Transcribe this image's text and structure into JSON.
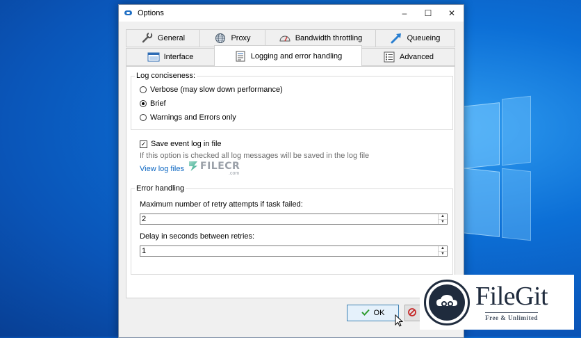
{
  "window": {
    "title": "Options",
    "controls": {
      "minimize": "–",
      "maximize": "☐",
      "close": "✕"
    }
  },
  "tabs": {
    "row1": [
      {
        "label": "General",
        "icon": "wrench-icon"
      },
      {
        "label": "Proxy",
        "icon": "globe-icon"
      },
      {
        "label": "Bandwidth throttling",
        "icon": "gauge-icon"
      },
      {
        "label": "Queueing",
        "icon": "arrow-icon"
      }
    ],
    "row2": [
      {
        "label": "Interface",
        "icon": "window-icon"
      },
      {
        "label": "Logging and error handling",
        "icon": "log-icon",
        "active": true
      },
      {
        "label": "Advanced",
        "icon": "list-icon"
      }
    ]
  },
  "logging": {
    "group_label": "Log conciseness:",
    "options": [
      {
        "label": "Verbose (may slow down performance)",
        "checked": false
      },
      {
        "label": "Brief",
        "checked": true
      },
      {
        "label": "Warnings and Errors only",
        "checked": false
      }
    ],
    "save_log_label": "Save event log in file",
    "save_log_checked": true,
    "save_log_hint": "If this option is checked all log messages will be saved in the log file",
    "view_log_link": "View log files"
  },
  "error_handling": {
    "group_label": "Error handling",
    "retry_label": "Maximum number of retry attempts if task failed:",
    "retry_value": "2",
    "delay_label": "Delay in seconds between retries:",
    "delay_value": "1"
  },
  "buttons": {
    "ok": "OK",
    "cancel": "C"
  },
  "watermark": {
    "text": "FILECR",
    "sub": ".com"
  },
  "overlay": {
    "brand": "FileGit",
    "tagline": "Free & Unlimited"
  },
  "colors": {
    "accent": "#0b66c2",
    "ok_border": "#3c7fb1",
    "desktop": "#0c6fd6"
  }
}
